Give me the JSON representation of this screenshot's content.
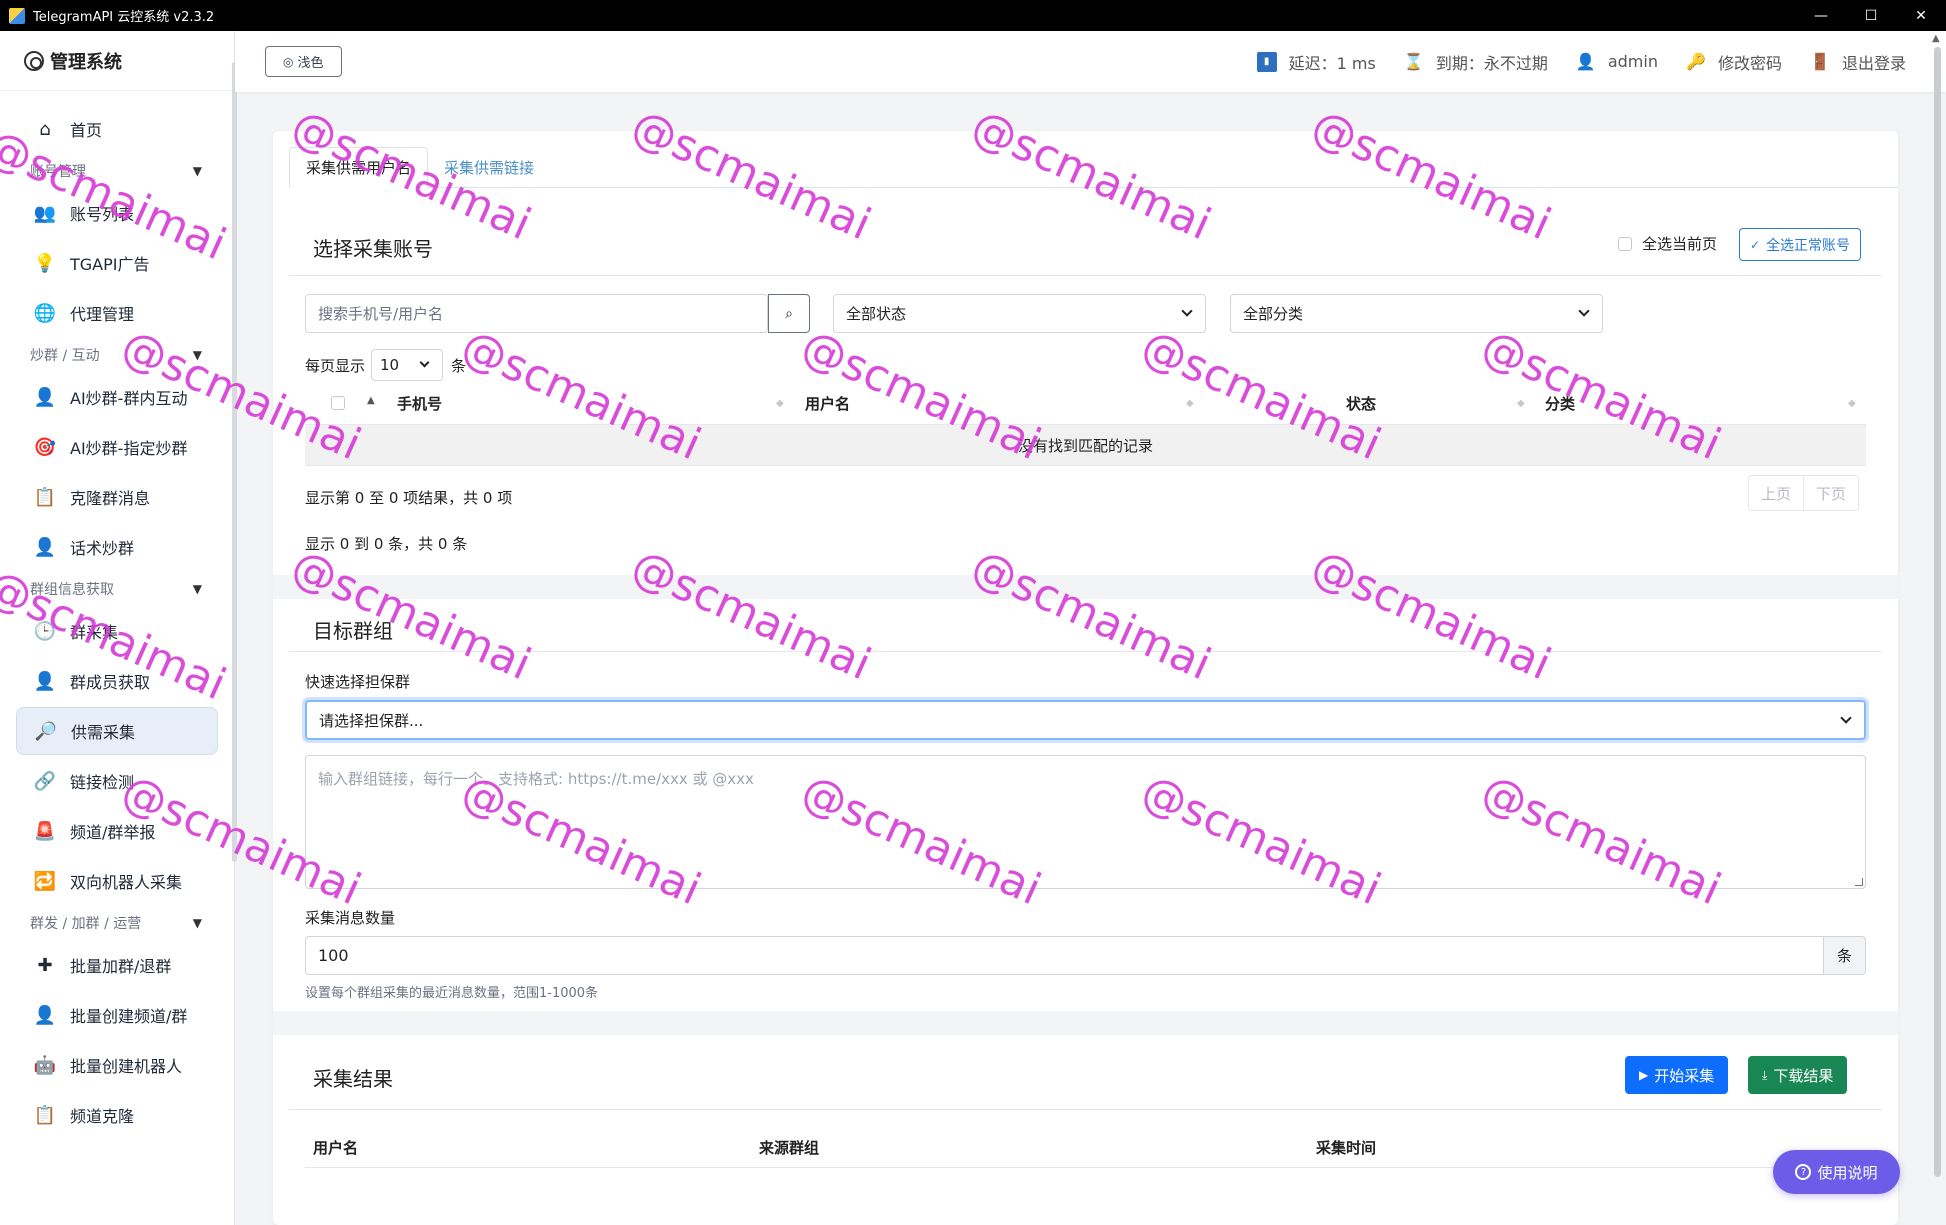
{
  "window": {
    "title": "TelegramAPI 云控系统 v2.3.2",
    "controls": [
      "—",
      "☐",
      "✕"
    ]
  },
  "sidebar": {
    "brand": "管理系统",
    "items": [
      {
        "type": "item",
        "label": "首页",
        "icon": "home-icon",
        "glyph": "⌂"
      },
      {
        "type": "group",
        "label": "账号管理"
      },
      {
        "type": "item",
        "label": "账号列表",
        "icon": "users-icon",
        "glyph": "👥"
      },
      {
        "type": "item",
        "label": "TGAPI广告",
        "icon": "lightbulb-icon",
        "glyph": "💡"
      },
      {
        "type": "item",
        "label": "代理管理",
        "icon": "globe-icon",
        "glyph": "🌐"
      },
      {
        "type": "group",
        "label": "炒群 / 互动"
      },
      {
        "type": "item",
        "label": "AI炒群-群内互动",
        "icon": "user-avatar-icon",
        "glyph": "👤"
      },
      {
        "type": "item",
        "label": "AI炒群-指定炒群",
        "icon": "target-icon",
        "glyph": "🎯"
      },
      {
        "type": "item",
        "label": "克隆群消息",
        "icon": "clipboard-icon",
        "glyph": "📋"
      },
      {
        "type": "item",
        "label": "话术炒群",
        "icon": "user-avatar-icon",
        "glyph": "👤"
      },
      {
        "type": "group",
        "label": "群组信息获取"
      },
      {
        "type": "item",
        "label": "群采集",
        "icon": "clock-icon",
        "glyph": "🕒"
      },
      {
        "type": "item",
        "label": "群成员获取",
        "icon": "user-avatar-icon",
        "glyph": "👤"
      },
      {
        "type": "item",
        "label": "供需采集",
        "icon": "magnifier-icon",
        "glyph": "🔎",
        "active": true
      },
      {
        "type": "item",
        "label": "链接检测",
        "icon": "link-icon",
        "glyph": "🔗"
      },
      {
        "type": "item",
        "label": "频道/群举报",
        "icon": "alarm-icon",
        "glyph": "🚨"
      },
      {
        "type": "item",
        "label": "双向机器人采集",
        "icon": "repeat-icon",
        "glyph": "🔁"
      },
      {
        "type": "group",
        "label": "群发 / 加群 / 运营"
      },
      {
        "type": "item",
        "label": "批量加群/退群",
        "icon": "plus-icon",
        "glyph": "✚"
      },
      {
        "type": "item",
        "label": "批量创建频道/群",
        "icon": "person-add-icon",
        "glyph": "👤"
      },
      {
        "type": "item",
        "label": "批量创建机器人",
        "icon": "robot-icon",
        "glyph": "🤖"
      },
      {
        "type": "item",
        "label": "频道克隆",
        "icon": "clipboard-icon",
        "glyph": "📋"
      }
    ]
  },
  "topbar": {
    "theme_button": "浅色",
    "latency_label": "延迟：1 ms",
    "expiry_label": "到期：永不过期",
    "user": "admin",
    "change_password": "修改密码",
    "logout": "退出登录"
  },
  "tabs": [
    "采集供需用户名",
    "采集供需链接"
  ],
  "account_section": {
    "title": "选择采集账号",
    "select_current_page": "全选当前页",
    "select_all_normal": "全选正常账号",
    "search_placeholder": "搜索手机号/用户名",
    "status_filter": "全部状态",
    "category_filter": "全部分类",
    "per_page_prefix": "每页显示",
    "per_page_value": "10",
    "per_page_suffix": "条",
    "columns": [
      "手机号",
      "用户名",
      "状态",
      "分类"
    ],
    "empty_text": "没有找到匹配的记录",
    "summary": "显示第 0 至 0 项结果，共 0 项",
    "prev": "上页",
    "next": "下页",
    "count_text": "显示 0 到 0 条，共 0 条"
  },
  "target_section": {
    "title": "目标群组",
    "quick_select_label": "快速选择担保群",
    "quick_select_value": "请选择担保群...",
    "links_placeholder": "输入群组链接，每行一个。支持格式: https://t.me/xxx 或 @xxx",
    "count_label": "采集消息数量",
    "count_value": "100",
    "count_unit": "条",
    "count_help": "设置每个群组采集的最近消息数量，范围1-1000条"
  },
  "result_section": {
    "title": "采集结果",
    "start_button": "开始采集",
    "download_button": "下载结果",
    "columns": [
      "用户名",
      "来源群组",
      "采集时间"
    ]
  },
  "help_button": "使用说明",
  "watermark": "@scmaimai",
  "colors": {
    "primary": "#0d6efd",
    "success": "#198754",
    "watermark": "#d63ad6",
    "help": "#6c5ce7"
  }
}
